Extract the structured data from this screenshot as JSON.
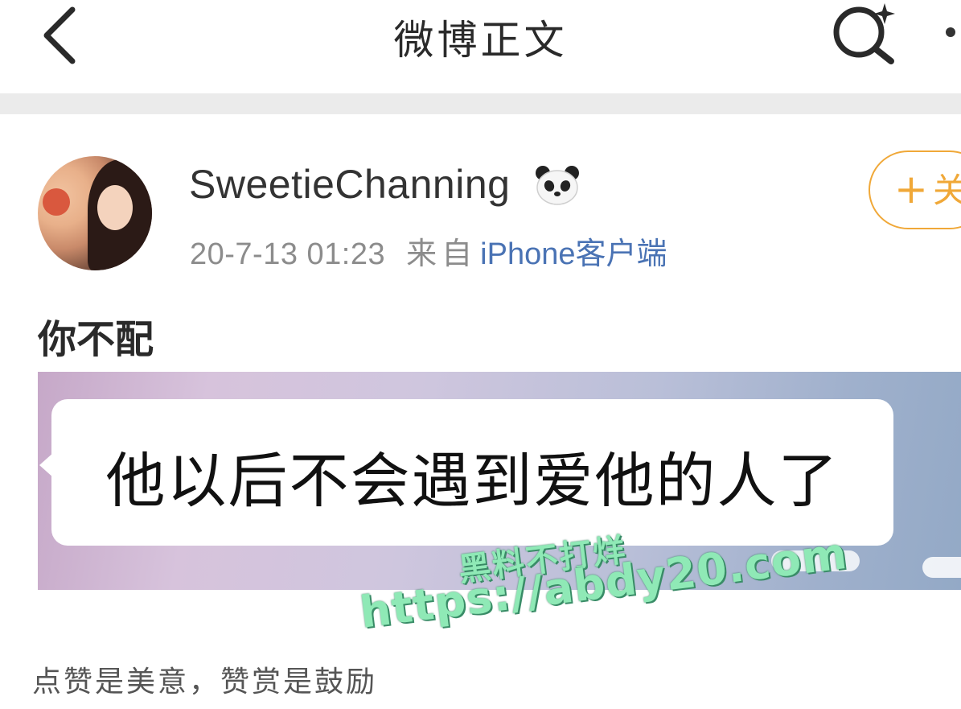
{
  "header": {
    "title": "微博正文"
  },
  "author": {
    "username": "SweetieChanning",
    "badge_icon": "panda-icon",
    "timestamp": "20-7-13 01:23",
    "from_label": "来自",
    "client": "iPhone客户端"
  },
  "follow": {
    "plus": "+",
    "label": "关"
  },
  "post": {
    "text": "你不配",
    "image_text": "他以后不会遇到爱他的人了"
  },
  "watermark": {
    "line1": "黑料不打烊",
    "line2": "https://abdy20.com"
  },
  "footer": {
    "reward_text": "点赞是美意，赞赏是鼓励"
  },
  "colors": {
    "accent_orange": "#f0a838",
    "link_blue": "#4a73b4",
    "divider": "#ebebeb"
  }
}
